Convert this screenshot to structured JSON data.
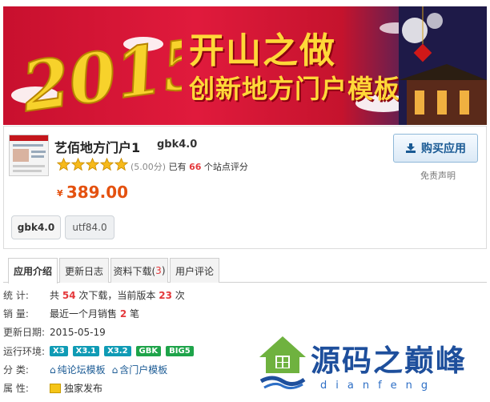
{
  "banner": {
    "year_text": "2015",
    "slogan_line1": "开山之做",
    "slogan_line2": "创新地方门户模板"
  },
  "product": {
    "name": "艺佰地方门户1",
    "version": "gbk4.0",
    "rating_score": "(5.00分)",
    "rating_prefix": "已有",
    "rating_count": "66",
    "rating_suffix": "个站点评分",
    "stars": 5,
    "price_symbol": "¥",
    "price": "389.00",
    "buy_label": "购买应用",
    "disclaimer": "免责声明",
    "versions": [
      "gbk4.0",
      "utf84.0"
    ]
  },
  "tabs": [
    {
      "label": "应用介绍",
      "count": ""
    },
    {
      "label": "更新日志",
      "count": ""
    },
    {
      "label": "资料下载(",
      "count": "3"
    },
    {
      "label": "用户评论",
      "count": ""
    }
  ],
  "details": {
    "stats_label": "统    计:",
    "stats_pre": "共",
    "downloads": "54",
    "stats_mid": "次下载，当前版本",
    "current_downloads": "23",
    "stats_end": "次",
    "sales_label": "销    量:",
    "sales_pre": "最近一个月销售",
    "sales": "2",
    "sales_end": "笔",
    "date_label": "更新日期:",
    "date": "2015-05-19",
    "env_label": "运行环境:",
    "environments": [
      "X3",
      "X3.1",
      "X3.2",
      "GBK",
      "BIG5"
    ],
    "category_label": "分    类:",
    "categories": [
      "纯论坛模板",
      "含门户模板"
    ],
    "attr_label": "属    性:",
    "attr": "独家发布"
  },
  "watermark": {
    "text": "源码之巅峰",
    "sub": "dianfeng"
  },
  "colors": {
    "banner_red": "#c8102e",
    "price": "#e4510f",
    "accent_red": "#e4393c",
    "link_blue": "#1a5a94",
    "env_blue": "#0f9bb5",
    "env_green": "#1ea44a"
  }
}
